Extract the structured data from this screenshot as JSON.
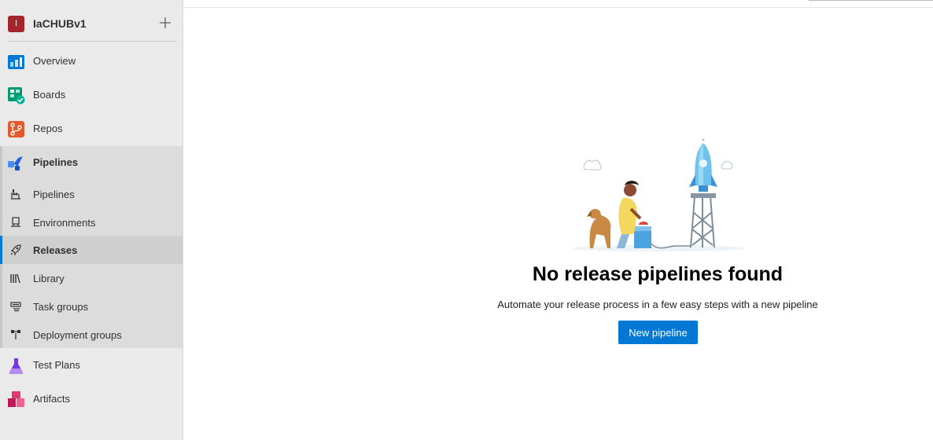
{
  "project": {
    "initial": "I",
    "name": "IaCHUBv1"
  },
  "nav": {
    "overview": "Overview",
    "boards": "Boards",
    "repos": "Repos",
    "pipelines": "Pipelines",
    "test_plans": "Test Plans",
    "artifacts": "Artifacts"
  },
  "pipelines_sub": {
    "pipelines": "Pipelines",
    "environments": "Environments",
    "releases": "Releases",
    "library": "Library",
    "task_groups": "Task groups",
    "deployment_groups": "Deployment groups"
  },
  "main": {
    "title": "No release pipelines found",
    "subtitle": "Automate your release process in a few easy steps with a new pipeline",
    "new_pipeline_label": "New pipeline"
  },
  "colors": {
    "accent": "#0078d4",
    "project_badge": "#a4262c",
    "sidebar_bg": "#eaeaea"
  },
  "icons": {
    "overview": "overview-icon",
    "boards": "boards-icon",
    "repos": "repos-icon",
    "pipelines": "pipelines-icon",
    "test_plans": "test-plans-icon",
    "artifacts": "artifacts-icon",
    "add": "plus-icon"
  }
}
